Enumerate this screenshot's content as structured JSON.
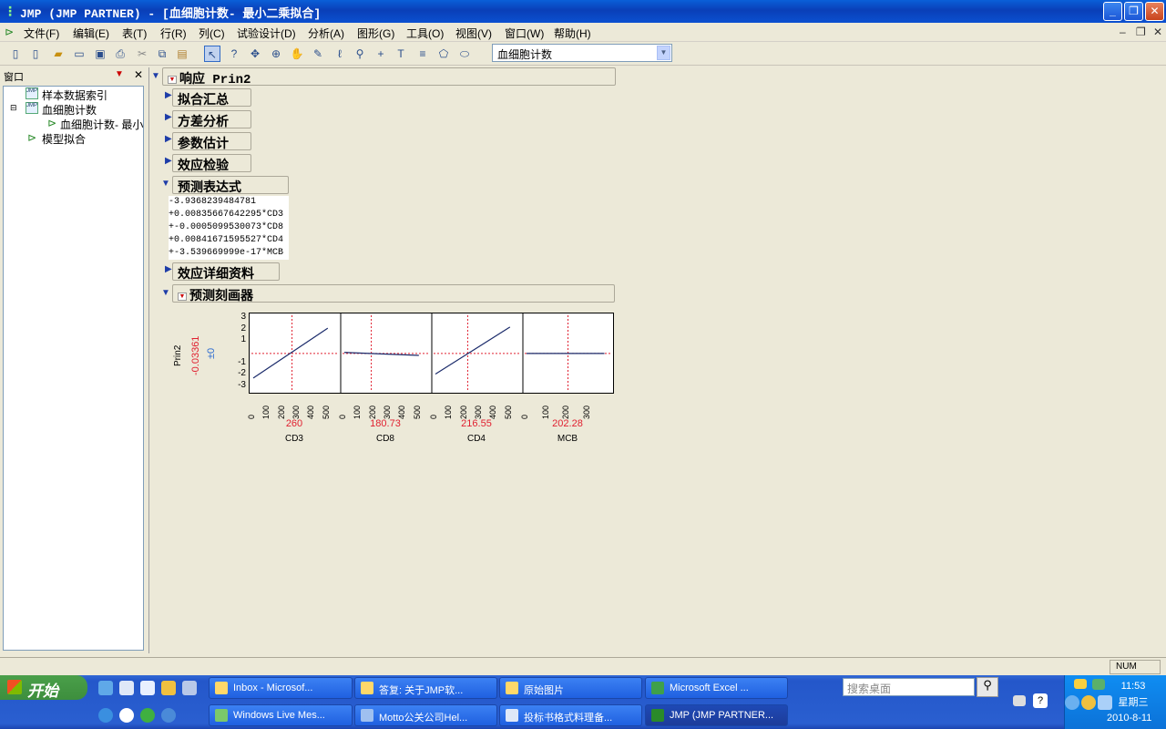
{
  "window": {
    "title": "JMP (JMP PARTNER)  - [血细胞计数- 最小二乘拟合]"
  },
  "menu": [
    "文件(F)",
    "编辑(E)",
    "表(T)",
    "行(R)",
    "列(C)",
    "试验设计(D)",
    "分析(A)",
    "图形(G)",
    "工具(O)",
    "视图(V)",
    "窗口(W)",
    "帮助(H)"
  ],
  "toolbar": {
    "table_select": "血细胞计数"
  },
  "left_pane": {
    "header": "窗口",
    "tree": [
      "样本数据索引",
      "血细胞计数",
      "血细胞计数- 最小",
      "模型拟合"
    ]
  },
  "report": {
    "title": "响应 Prin2",
    "sections": [
      "拟合汇总",
      "方差分析",
      "参数估计",
      "效应检验",
      "预测表达式"
    ],
    "expression": [
      "-3.9368239484781",
      "+0.00835667642295*CD3",
      "+-0.0005099530073*CD8",
      "+0.00841671595527*CD4",
      "+-3.539669999e-17*MCB"
    ],
    "details": "效应详细资料",
    "profiler": "预测刻画器"
  },
  "chart_data": {
    "type": "line",
    "ylabel": "Prin2",
    "current_y": "-0.03361",
    "ci": "±0",
    "yticks": [
      "3",
      "2",
      "1",
      "-1",
      "-2",
      "-3"
    ],
    "ylim": [
      -3.5,
      3.5
    ],
    "factors": [
      {
        "name": "CD3",
        "current": "260",
        "xticks": [
          "0",
          "100",
          "200",
          "300",
          "400",
          "500"
        ],
        "xlim": [
          0,
          550
        ],
        "x": [
          0,
          500
        ],
        "y": [
          -2.2,
          2.2
        ]
      },
      {
        "name": "CD8",
        "current": "180.73",
        "xticks": [
          "0",
          "100",
          "200",
          "300",
          "400",
          "500"
        ],
        "xlim": [
          0,
          550
        ],
        "x": [
          0,
          500
        ],
        "y": [
          0.06,
          -0.2
        ]
      },
      {
        "name": "CD4",
        "current": "216.55",
        "xticks": [
          "0",
          "100",
          "200",
          "300",
          "400",
          "500"
        ],
        "xlim": [
          0,
          550
        ],
        "x": [
          0,
          500
        ],
        "y": [
          -1.85,
          2.3
        ]
      },
      {
        "name": "MCB",
        "current": "202.28",
        "xticks": [
          "0",
          "100",
          "200",
          "300"
        ],
        "xlim": [
          0,
          400
        ],
        "x": [
          0,
          380
        ],
        "y": [
          -0.03,
          -0.03
        ]
      }
    ]
  },
  "status": {
    "num": "NUM"
  },
  "taskbar": {
    "start": "开始",
    "tasks": [
      "Inbox - Microsof...",
      "答复: 关于JMP软...",
      "原始图片",
      "Microsoft Excel ...",
      "Windows Live Mes...",
      "Motto公关公司Hel...",
      "投标书格式料理备...",
      "JMP (JMP PARTNER..."
    ],
    "search_placeholder": "搜索桌面",
    "time": "11:53",
    "weekday": "星期三",
    "date": "2010-8-11"
  }
}
